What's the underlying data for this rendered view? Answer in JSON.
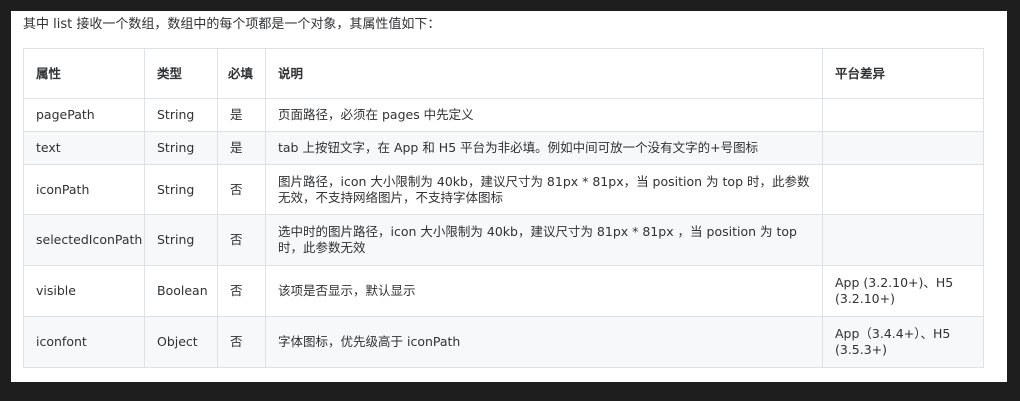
{
  "intro": "其中 list 接收一个数组，数组中的每个项都是一个对象，其属性值如下：",
  "table": {
    "headers": [
      "属性",
      "类型",
      "必填",
      "说明",
      "平台差异"
    ],
    "rows": [
      [
        "pagePath",
        "String",
        "是",
        "页面路径，必须在 pages 中先定义",
        ""
      ],
      [
        "text",
        "String",
        "是",
        "tab 上按钮文字，在 App 和 H5 平台为非必填。例如中间可放一个没有文字的+号图标",
        ""
      ],
      [
        "iconPath",
        "String",
        "否",
        "图片路径，icon 大小限制为 40kb，建议尺寸为 81px * 81px，当 position 为 top 时，此参数无效，不支持网络图片，不支持字体图标",
        ""
      ],
      [
        "selectedIconPath",
        "String",
        "否",
        "选中时的图片路径，icon 大小限制为 40kb，建议尺寸为 81px * 81px ，当 position 为 top 时，此参数无效",
        ""
      ],
      [
        "visible",
        "Boolean",
        "否",
        "该项是否显示，默认显示",
        "App (3.2.10+)、H5 (3.2.10+)"
      ],
      [
        "iconfont",
        "Object",
        "否",
        "字体图标，优先级高于 iconPath",
        "App（3.4.4+）、H5 (3.5.3+)"
      ]
    ]
  }
}
